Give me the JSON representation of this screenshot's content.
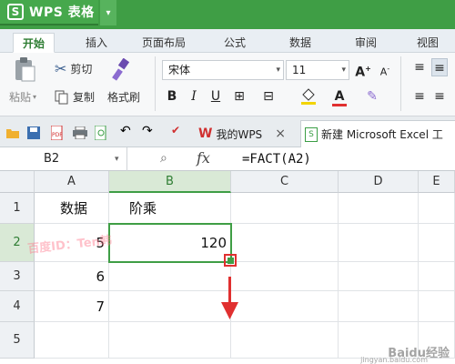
{
  "app": {
    "logo_letter": "S",
    "name": "WPS 表格",
    "drop_arrow": "▾"
  },
  "tabs": [
    {
      "label": "开始",
      "active": true
    },
    {
      "label": "插入",
      "active": false
    },
    {
      "label": "页面布局",
      "active": false
    },
    {
      "label": "公式",
      "active": false
    },
    {
      "label": "数据",
      "active": false
    },
    {
      "label": "审阅",
      "active": false
    },
    {
      "label": "视图",
      "active": false
    }
  ],
  "ribbon": {
    "paste_label": "粘贴",
    "cut_label": "剪切",
    "copy_label": "复制",
    "format_painter_label": "格式刷",
    "font_name": "宋体",
    "font_size": "11",
    "bold": "B",
    "italic": "I",
    "underline": "U",
    "grow_font": "A",
    "shrink_font": "A",
    "font_color": "A"
  },
  "doc_tabs": [
    {
      "label": "我的WPS",
      "close": "×"
    },
    {
      "label": "新建 Microsoft Excel 工"
    }
  ],
  "formula_bar": {
    "name_box": "B2",
    "fx": "fx",
    "formula": "=FACT(A2)"
  },
  "sheet": {
    "columns": [
      "A",
      "B",
      "C",
      "D",
      "E"
    ],
    "rows": [
      "1",
      "2",
      "3",
      "4",
      "5"
    ],
    "cells": {
      "A1": "数据",
      "B1": "阶乘",
      "A2": "5",
      "B2": "120",
      "A3": "6",
      "A4": "7"
    },
    "active_cell": "B2"
  },
  "watermark": {
    "left_text": "百度ID：Ten韩",
    "right_text": "Baidu经验",
    "url": "jingyan.baidu.com"
  },
  "colors": {
    "accent": "#3f9e45",
    "annotation": "#e03030"
  }
}
